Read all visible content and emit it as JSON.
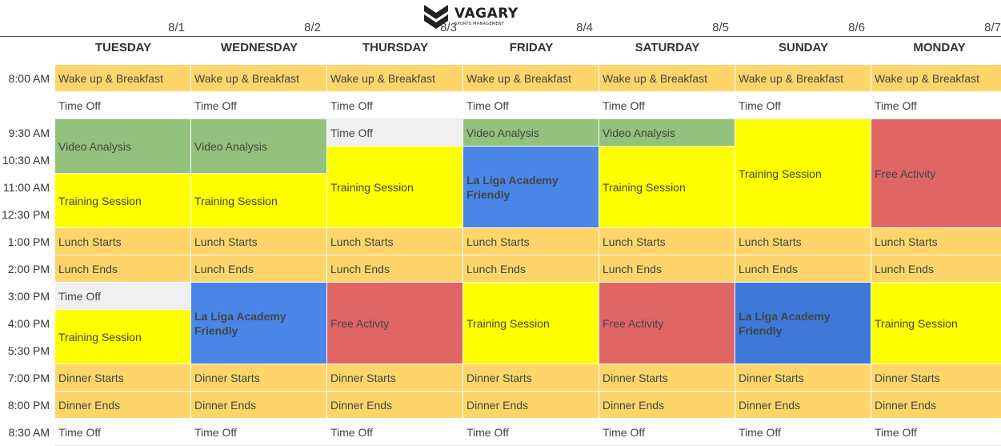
{
  "logo": {
    "word": "VAGARY",
    "subtitle": "SPORTS MANAGEMENT"
  },
  "colors": {
    "orange": "#fdd56a",
    "white": "#ffffff",
    "grey": "#f0f0f0",
    "green": "#92c27b",
    "yellow": "#ffff00",
    "blue": "#4a86e8",
    "red": "#e06666",
    "dark_blue": "#3d78d8"
  },
  "days": [
    {
      "date": "8/1",
      "name": "TUESDAY"
    },
    {
      "date": "8/2",
      "name": "WEDNESDAY"
    },
    {
      "date": "8/3",
      "name": "THURSDAY"
    },
    {
      "date": "8/4",
      "name": "FRIDAY"
    },
    {
      "date": "8/5",
      "name": "SATURDAY"
    },
    {
      "date": "8/6",
      "name": "SUNDAY"
    },
    {
      "date": "8/7",
      "name": "MONDAY"
    }
  ],
  "times": [
    "8:00 AM",
    "",
    "9:30 AM",
    "10:30 AM",
    "11:00 AM",
    "12:30 PM",
    "1:00 PM",
    "2:00 PM",
    "3:00 PM",
    "4:00 PM",
    "5:30 PM",
    "7:00 PM",
    "8:00 PM",
    "8:30 AM"
  ],
  "events": [
    {
      "day": 0,
      "start": 0,
      "span": 1,
      "label": "Wake up & Breakfast",
      "color": "orange"
    },
    {
      "day": 0,
      "start": 1,
      "span": 1,
      "label": "Time Off",
      "color": "white"
    },
    {
      "day": 0,
      "start": 2,
      "span": 2,
      "label": "Video Analysis",
      "color": "green"
    },
    {
      "day": 0,
      "start": 4,
      "span": 2,
      "label": "Training Session",
      "color": "yellow"
    },
    {
      "day": 0,
      "start": 6,
      "span": 1,
      "label": "Lunch Starts",
      "color": "orange"
    },
    {
      "day": 0,
      "start": 7,
      "span": 1,
      "label": "Lunch Ends",
      "color": "orange"
    },
    {
      "day": 0,
      "start": 8,
      "span": 1,
      "label": "Time Off",
      "color": "grey"
    },
    {
      "day": 0,
      "start": 9,
      "span": 2,
      "label": "Training Session",
      "color": "yellow"
    },
    {
      "day": 0,
      "start": 11,
      "span": 1,
      "label": "Dinner Starts",
      "color": "orange"
    },
    {
      "day": 0,
      "start": 12,
      "span": 1,
      "label": "Dinner Ends",
      "color": "orange"
    },
    {
      "day": 0,
      "start": 13,
      "span": 1,
      "label": "Time Off",
      "color": "white"
    },
    {
      "day": 1,
      "start": 0,
      "span": 1,
      "label": "Wake up & Breakfast",
      "color": "orange"
    },
    {
      "day": 1,
      "start": 1,
      "span": 1,
      "label": "Time Off",
      "color": "white"
    },
    {
      "day": 1,
      "start": 2,
      "span": 2,
      "label": "Video Analysis",
      "color": "green"
    },
    {
      "day": 1,
      "start": 4,
      "span": 2,
      "label": "Training Session",
      "color": "yellow"
    },
    {
      "day": 1,
      "start": 6,
      "span": 1,
      "label": "Lunch Starts",
      "color": "orange"
    },
    {
      "day": 1,
      "start": 7,
      "span": 1,
      "label": "Lunch Ends",
      "color": "orange"
    },
    {
      "day": 1,
      "start": 8,
      "span": 3,
      "label": "La Liga Academy Friendly",
      "color": "blue",
      "bold": true
    },
    {
      "day": 1,
      "start": 11,
      "span": 1,
      "label": "Dinner Starts",
      "color": "orange"
    },
    {
      "day": 1,
      "start": 12,
      "span": 1,
      "label": "Dinner Ends",
      "color": "orange"
    },
    {
      "day": 1,
      "start": 13,
      "span": 1,
      "label": "Time Off",
      "color": "white"
    },
    {
      "day": 2,
      "start": 0,
      "span": 1,
      "label": "Wake up & Breakfast",
      "color": "orange"
    },
    {
      "day": 2,
      "start": 1,
      "span": 1,
      "label": "Time Off",
      "color": "white"
    },
    {
      "day": 2,
      "start": 2,
      "span": 1,
      "label": "Time Off",
      "color": "grey"
    },
    {
      "day": 2,
      "start": 3,
      "span": 3,
      "label": "Training Session",
      "color": "yellow"
    },
    {
      "day": 2,
      "start": 6,
      "span": 1,
      "label": "Lunch Starts",
      "color": "orange"
    },
    {
      "day": 2,
      "start": 7,
      "span": 1,
      "label": "Lunch Ends",
      "color": "orange"
    },
    {
      "day": 2,
      "start": 8,
      "span": 3,
      "label": "Free Activty",
      "color": "red"
    },
    {
      "day": 2,
      "start": 11,
      "span": 1,
      "label": "Dinner Starts",
      "color": "orange"
    },
    {
      "day": 2,
      "start": 12,
      "span": 1,
      "label": "Dinner Ends",
      "color": "orange"
    },
    {
      "day": 2,
      "start": 13,
      "span": 1,
      "label": "Time Off",
      "color": "white"
    },
    {
      "day": 3,
      "start": 0,
      "span": 1,
      "label": "Wake up & Breakfast",
      "color": "orange"
    },
    {
      "day": 3,
      "start": 1,
      "span": 1,
      "label": "Time Off",
      "color": "white"
    },
    {
      "day": 3,
      "start": 2,
      "span": 1,
      "label": "Video Analysis",
      "color": "green"
    },
    {
      "day": 3,
      "start": 3,
      "span": 3,
      "label": "La Liga Academy Friendly",
      "color": "blue",
      "bold": true
    },
    {
      "day": 3,
      "start": 6,
      "span": 1,
      "label": "Lunch Starts",
      "color": "orange"
    },
    {
      "day": 3,
      "start": 7,
      "span": 1,
      "label": "Lunch Ends",
      "color": "orange"
    },
    {
      "day": 3,
      "start": 8,
      "span": 3,
      "label": "Training Session",
      "color": "yellow"
    },
    {
      "day": 3,
      "start": 11,
      "span": 1,
      "label": "Dinner Starts",
      "color": "orange"
    },
    {
      "day": 3,
      "start": 12,
      "span": 1,
      "label": "Dinner Ends",
      "color": "orange"
    },
    {
      "day": 3,
      "start": 13,
      "span": 1,
      "label": "Time Off",
      "color": "white"
    },
    {
      "day": 4,
      "start": 0,
      "span": 1,
      "label": "Wake up & Breakfast",
      "color": "orange"
    },
    {
      "day": 4,
      "start": 1,
      "span": 1,
      "label": "Time Off",
      "color": "white"
    },
    {
      "day": 4,
      "start": 2,
      "span": 1,
      "label": "Video Analysis",
      "color": "green"
    },
    {
      "day": 4,
      "start": 3,
      "span": 3,
      "label": "Training Session",
      "color": "yellow"
    },
    {
      "day": 4,
      "start": 6,
      "span": 1,
      "label": "Lunch Starts",
      "color": "orange"
    },
    {
      "day": 4,
      "start": 7,
      "span": 1,
      "label": "Lunch Ends",
      "color": "orange"
    },
    {
      "day": 4,
      "start": 8,
      "span": 3,
      "label": "Free Activity",
      "color": "red"
    },
    {
      "day": 4,
      "start": 11,
      "span": 1,
      "label": "Dinner Starts",
      "color": "orange"
    },
    {
      "day": 4,
      "start": 12,
      "span": 1,
      "label": "Dinner Ends",
      "color": "orange"
    },
    {
      "day": 4,
      "start": 13,
      "span": 1,
      "label": "Time Off",
      "color": "white"
    },
    {
      "day": 5,
      "start": 0,
      "span": 1,
      "label": "Wake up & Breakfast",
      "color": "orange"
    },
    {
      "day": 5,
      "start": 1,
      "span": 1,
      "label": "Time Off",
      "color": "white"
    },
    {
      "day": 5,
      "start": 2,
      "span": 4,
      "label": "Training Session",
      "color": "yellow"
    },
    {
      "day": 5,
      "start": 6,
      "span": 1,
      "label": "Lunch Starts",
      "color": "orange"
    },
    {
      "day": 5,
      "start": 7,
      "span": 1,
      "label": "Lunch Ends",
      "color": "orange"
    },
    {
      "day": 5,
      "start": 8,
      "span": 3,
      "label": "La Liga Academy Friendly",
      "color": "dark_blue",
      "bold": true
    },
    {
      "day": 5,
      "start": 11,
      "span": 1,
      "label": "Dinner Starts",
      "color": "orange"
    },
    {
      "day": 5,
      "start": 12,
      "span": 1,
      "label": "Dinner Ends",
      "color": "orange"
    },
    {
      "day": 5,
      "start": 13,
      "span": 1,
      "label": "Time Off",
      "color": "white"
    },
    {
      "day": 6,
      "start": 0,
      "span": 1,
      "label": "Wake up & Breakfast",
      "color": "orange"
    },
    {
      "day": 6,
      "start": 1,
      "span": 1,
      "label": "Time Off",
      "color": "white"
    },
    {
      "day": 6,
      "start": 2,
      "span": 4,
      "label": "Free Activity",
      "color": "red"
    },
    {
      "day": 6,
      "start": 6,
      "span": 1,
      "label": "Lunch Starts",
      "color": "orange"
    },
    {
      "day": 6,
      "start": 7,
      "span": 1,
      "label": "Lunch Ends",
      "color": "orange"
    },
    {
      "day": 6,
      "start": 8,
      "span": 3,
      "label": "Training Session",
      "color": "yellow"
    },
    {
      "day": 6,
      "start": 11,
      "span": 1,
      "label": "Dinner Starts",
      "color": "orange"
    },
    {
      "day": 6,
      "start": 12,
      "span": 1,
      "label": "Dinner Ends",
      "color": "orange"
    },
    {
      "day": 6,
      "start": 13,
      "span": 1,
      "label": "Time Off",
      "color": "white"
    }
  ]
}
